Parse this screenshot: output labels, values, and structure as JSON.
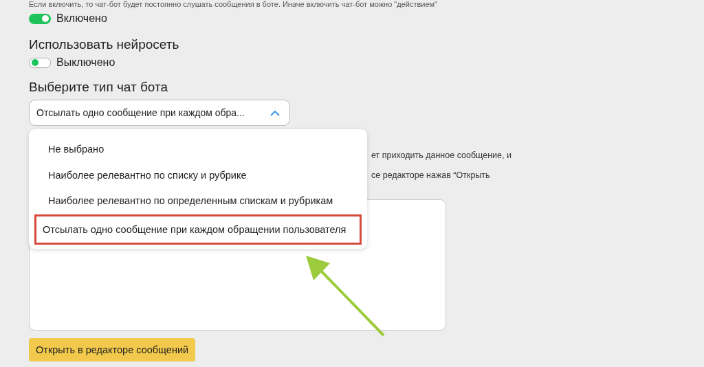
{
  "intro_text": "Если включить, то чат-бот будет постоянно слушать сообщения в боте. Иначе включить чат-бот можно \"действием\"",
  "bot_toggle": {
    "on": true,
    "label": "Включено"
  },
  "neural": {
    "title": "Использовать нейросеть",
    "toggle": {
      "on": false,
      "label": "Выключено"
    }
  },
  "bot_type": {
    "title": "Выберите тип чат бота",
    "value": "Отсылать одно сообщение при каждом обра...",
    "expanded": true,
    "options": [
      {
        "label": "Не выбрано",
        "selected": false
      },
      {
        "label": "Наиболее релевантно по списку и рубрике",
        "selected": false
      },
      {
        "label": "Наиболее релевантно по определенным спискам и рубрикам",
        "selected": false
      },
      {
        "label": "Отсылать одно сообщение при каждом обращении пользователя",
        "selected": true
      }
    ]
  },
  "hint_lines": [
    "ет приходить данное сообщение, и",
    "се редакторе нажав “Открыть"
  ],
  "open_editor_button": "Открыть в редакторе сообщений"
}
